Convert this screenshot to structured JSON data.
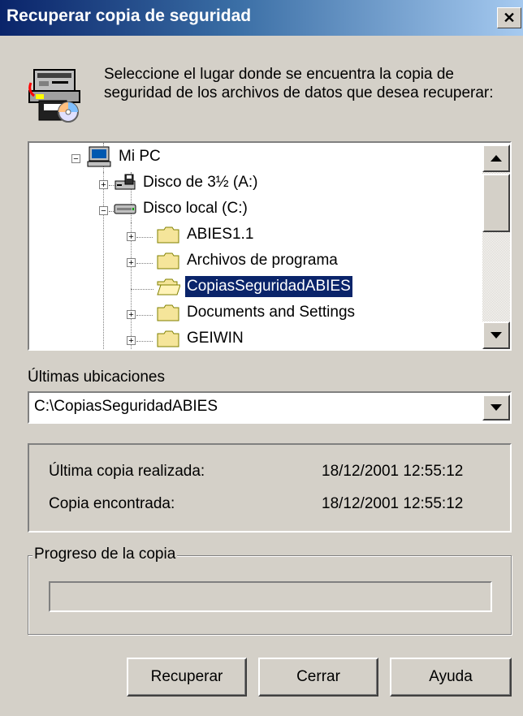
{
  "window": {
    "title": "Recuperar copia de seguridad",
    "close_glyph": "✕"
  },
  "instructions": "Seleccione el lugar donde se encuentra la copia de seguridad de los archivos de datos que desea recuperar:",
  "tree": {
    "items": [
      {
        "label": "Mi PC",
        "icon": "computer-icon",
        "expander": "−"
      },
      {
        "label": "Disco de 3½ (A:)",
        "icon": "floppy-drive-icon",
        "expander": "+"
      },
      {
        "label": "Disco local (C:)",
        "icon": "hard-drive-icon",
        "expander": "−"
      },
      {
        "label": "ABIES1.1",
        "icon": "folder-icon",
        "expander": "+"
      },
      {
        "label": "Archivos de programa",
        "icon": "folder-icon",
        "expander": "+"
      },
      {
        "label": "CopiasSeguridadABIES",
        "icon": "open-folder-icon",
        "expander": "",
        "selected": true
      },
      {
        "label": "Documents and Settings",
        "icon": "folder-icon",
        "expander": "+"
      },
      {
        "label": "GEIWIN",
        "icon": "folder-icon",
        "expander": "+"
      }
    ]
  },
  "last_locations": {
    "label": "Últimas ubicaciones",
    "value": "C:\\CopiasSeguridadABIES"
  },
  "info": {
    "last_copy_label": "Última copia realizada:",
    "last_copy_value": "18/12/2001 12:55:12",
    "found_copy_label": "Copia encontrada:",
    "found_copy_value": "18/12/2001 12:55:12"
  },
  "progress": {
    "group_title": "Progreso de la copia",
    "value": 0
  },
  "buttons": {
    "recover": "Recuperar",
    "close": "Cerrar",
    "help": "Ayuda"
  },
  "colors": {
    "title_start": "#0a246a",
    "title_end": "#a6caf0",
    "face": "#d4d0c8",
    "selection": "#0a246a",
    "folder": "#f5e59a"
  }
}
